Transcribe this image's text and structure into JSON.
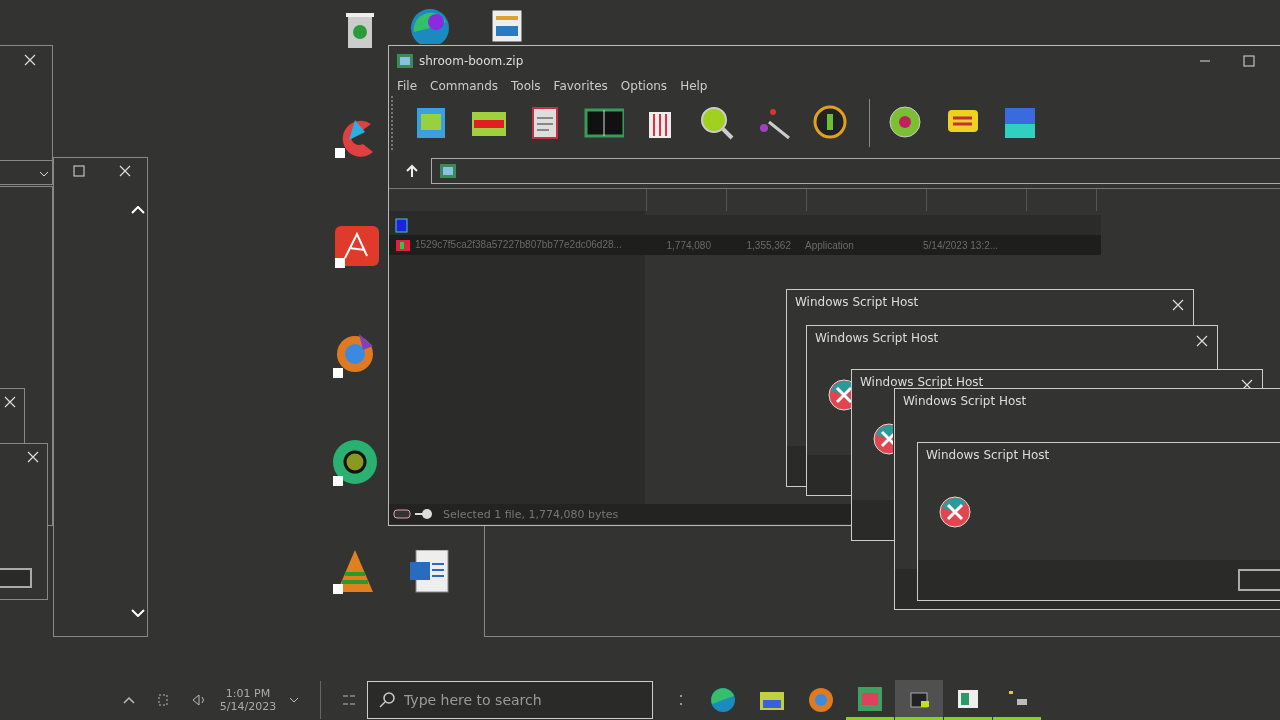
{
  "archive_window": {
    "title": "shroom-boom.zip",
    "menu": [
      "File",
      "Commands",
      "Tools",
      "Favorites",
      "Options",
      "Help"
    ],
    "files": [
      {
        "kind": "folder",
        "selected": false
      },
      {
        "kind": "file",
        "name": "1529c7f5ca2f38a57227b807bb77e2dc06d28...",
        "size": "1,774,080",
        "packed": "1,355,362",
        "type": "Application",
        "modified": "5/14/2023 13:2...",
        "selected": true
      }
    ],
    "status": "Selected 1 file, 1,774,080 bytes"
  },
  "dialogs": [
    {
      "title": "Windows Script Host"
    },
    {
      "title": "Windows Script Host"
    },
    {
      "title": "Windows Script Host"
    },
    {
      "title": "Windows Script Host"
    },
    {
      "title": "Windows Script Host"
    }
  ],
  "taskbar": {
    "time": "1:01 PM",
    "date": "5/14/2023",
    "search": {
      "placeholder": "Type here to search"
    },
    "apps": [
      {
        "running": false,
        "selected": false
      },
      {
        "running": false,
        "selected": false
      },
      {
        "running": false,
        "selected": false
      },
      {
        "running": true,
        "selected": false
      },
      {
        "running": true,
        "selected": true
      },
      {
        "running": true,
        "selected": false
      },
      {
        "running": true,
        "selected": false
      }
    ]
  }
}
